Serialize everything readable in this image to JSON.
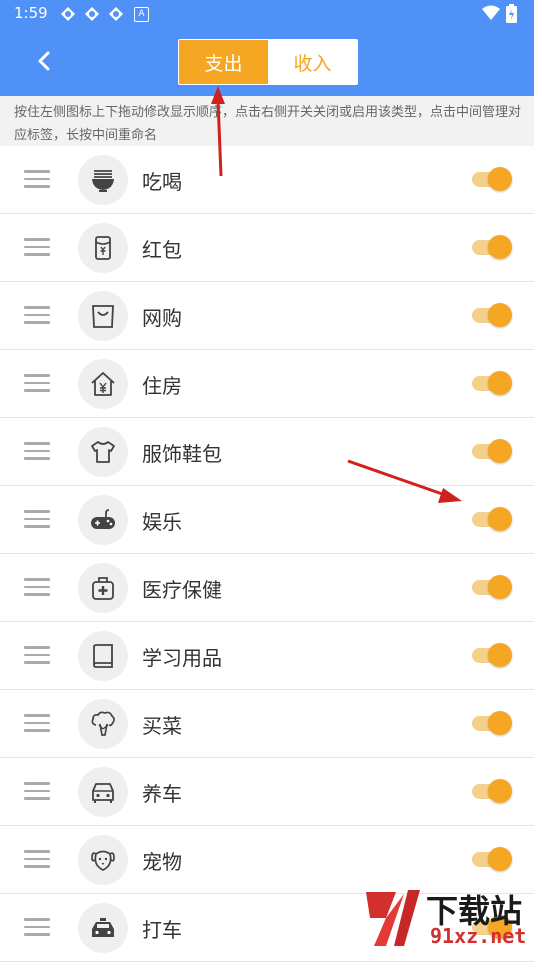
{
  "status_bar": {
    "time": "1:59",
    "notif_badge": "A"
  },
  "header": {
    "back_icon": "chevron-left-icon",
    "tabs": [
      {
        "label": "支出",
        "active": true
      },
      {
        "label": "收入",
        "active": false
      }
    ]
  },
  "hint": "按住左侧图标上下拖动修改显示顺序，点击右侧开关关闭或启用该类型，点击中间管理对应标签，长按中间重命名",
  "categories": [
    {
      "label": "吃喝",
      "icon": "noodle-bowl-icon",
      "enabled": true
    },
    {
      "label": "红包",
      "icon": "red-envelope-icon",
      "enabled": true
    },
    {
      "label": "网购",
      "icon": "shopping-bag-icon",
      "enabled": true
    },
    {
      "label": "住房",
      "icon": "house-yen-icon",
      "enabled": true
    },
    {
      "label": "服饰鞋包",
      "icon": "tshirt-icon",
      "enabled": true
    },
    {
      "label": "娱乐",
      "icon": "gamepad-icon",
      "enabled": true
    },
    {
      "label": "医疗保健",
      "icon": "medical-kit-icon",
      "enabled": true
    },
    {
      "label": "学习用品",
      "icon": "book-icon",
      "enabled": true
    },
    {
      "label": "买菜",
      "icon": "broccoli-icon",
      "enabled": true
    },
    {
      "label": "养车",
      "icon": "car-icon",
      "enabled": true
    },
    {
      "label": "宠物",
      "icon": "dog-icon",
      "enabled": true
    },
    {
      "label": "打车",
      "icon": "taxi-icon",
      "enabled": true
    }
  ],
  "watermark": {
    "title": "下载站",
    "url": "91xz.net",
    "brand_color": "#d32f2f"
  },
  "colors": {
    "header": "#4f91f6",
    "accent": "#f5a623",
    "arrow": "#d0211c"
  }
}
